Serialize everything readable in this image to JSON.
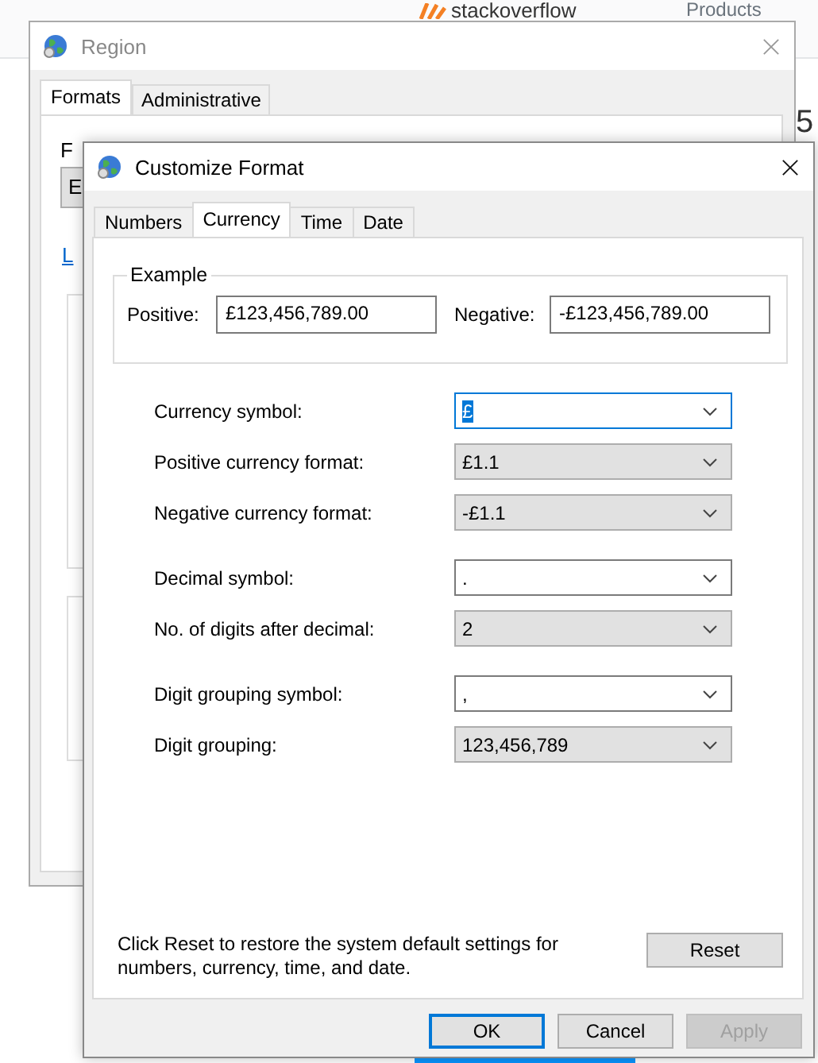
{
  "background_page": {
    "logo": "stackoverflow",
    "nav_item": "Products",
    "edge_text": "5"
  },
  "region_window": {
    "title": "Region",
    "tabs": [
      {
        "label": "Formats",
        "selected": true
      },
      {
        "label": "Administrative",
        "selected": false
      }
    ],
    "format_label": "F",
    "format_value": "E",
    "link": "L"
  },
  "customize_dialog": {
    "title": "Customize Format",
    "tabs": [
      {
        "label": "Numbers",
        "selected": false
      },
      {
        "label": "Currency",
        "selected": true
      },
      {
        "label": "Time",
        "selected": false
      },
      {
        "label": "Date",
        "selected": false
      }
    ],
    "example": {
      "title": "Example",
      "positive_label": "Positive:",
      "positive_value": "£123,456,789.00",
      "negative_label": "Negative:",
      "negative_value": "-£123,456,789.00"
    },
    "setting_groups": [
      [
        {
          "label": "Currency symbol:",
          "value": "£",
          "kind": "editable",
          "focused": true
        },
        {
          "label": "Positive currency format:",
          "value": "£1.1",
          "kind": "list",
          "focused": false
        },
        {
          "label": "Negative currency format:",
          "value": "-£1.1",
          "kind": "list",
          "focused": false
        }
      ],
      [
        {
          "label": "Decimal symbol:",
          "value": ".",
          "kind": "editable",
          "focused": false
        },
        {
          "label": "No. of digits after decimal:",
          "value": "2",
          "kind": "list",
          "focused": false
        }
      ],
      [
        {
          "label": "Digit grouping symbol:",
          "value": ",",
          "kind": "editable",
          "focused": false
        },
        {
          "label": "Digit grouping:",
          "value": "123,456,789",
          "kind": "list",
          "focused": false
        }
      ]
    ],
    "note": "Click Reset to restore the system default settings for numbers, currency, time, and date.",
    "reset_button": "Reset",
    "buttons": [
      {
        "label": "OK",
        "default": true,
        "disabled": false
      },
      {
        "label": "Cancel",
        "default": false,
        "disabled": false
      },
      {
        "label": "Apply",
        "default": false,
        "disabled": true
      }
    ]
  }
}
